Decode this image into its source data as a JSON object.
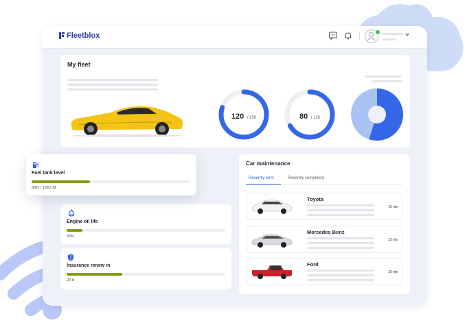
{
  "app": {
    "brand": "Fleetblox"
  },
  "fleet": {
    "title": "My fleet",
    "gauges": [
      {
        "value": "120",
        "total": "/ 150",
        "fraction": 0.8
      },
      {
        "value": "80",
        "total": "/ 120",
        "fraction": 0.6667
      }
    ],
    "pie_fraction": 0.55
  },
  "fuel": {
    "label": "Fuel tank level",
    "value": "80% / 158.5 M",
    "percent": 37
  },
  "oil": {
    "label": "Engine oil life",
    "value": "30%",
    "percent": 10
  },
  "insurance": {
    "label": "Insurance renew in",
    "value": "20 d",
    "percent": 35
  },
  "maintenance": {
    "title": "Car maintenance",
    "tabs": [
      "Recently sent",
      "Recently completed"
    ],
    "items": [
      {
        "name": "Toyota",
        "time": "15 min"
      },
      {
        "name": "Mercedes Benz",
        "time": "15 min"
      },
      {
        "name": "Ford",
        "time": "15 min"
      }
    ]
  },
  "colors": {
    "accent": "#3567e8",
    "bar": "#8a9a10",
    "pie_light": "#a8c2f3"
  }
}
